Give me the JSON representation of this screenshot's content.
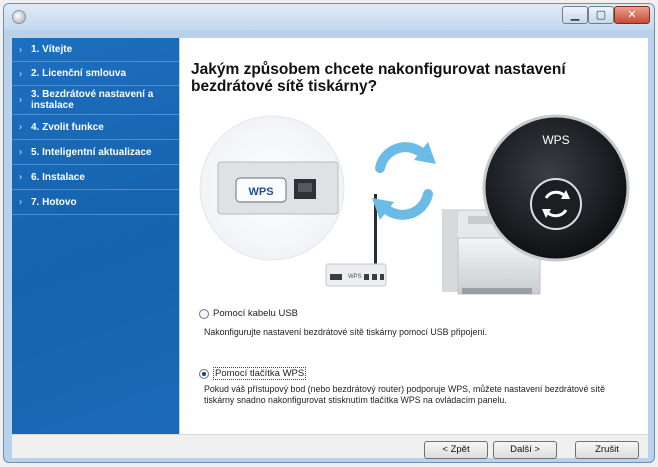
{
  "window": {
    "title": ""
  },
  "sidebar": {
    "items": [
      {
        "label": "1. Vítejte"
      },
      {
        "label": "2. Licenční smlouva"
      },
      {
        "label": "3. Bezdrátové nastavení a instalace"
      },
      {
        "label": "4. Zvolit funkce"
      },
      {
        "label": "5. Inteligentní aktualizace"
      },
      {
        "label": "6. Instalace"
      },
      {
        "label": "7. Hotovo"
      }
    ]
  },
  "main": {
    "heading": "Jakým způsobem chcete nakonfigurovat nastavení bezdrátové sítě tiskárny?",
    "illustration": {
      "wps_button_label": "WPS",
      "wps_badge_label": "WPS",
      "router_label": "WPS"
    },
    "options": [
      {
        "label": "Pomocí kabelu USB",
        "selected": false,
        "description": "Nakonfigurujte nastavení bezdrátové sítě tiskárny pomocí USB připojení."
      },
      {
        "label": "Pomocí tlačítka WPS",
        "selected": true,
        "description": "Pokud váš přístupový bod (nebo bezdrátový router) podporuje WPS, můžete nastavení bezdrátové sítě tiskárny snadno nakonfigurovat stisknutím tlačítka WPS na ovládacím panelu."
      }
    ]
  },
  "buttons": {
    "back": "< Zpět",
    "next": "Další >",
    "cancel": "Zrušit"
  },
  "titlebar": {
    "minimize": "▁",
    "maximize": "▢",
    "close": "✕"
  },
  "colors": {
    "sidebar": "#1a66b3",
    "wps_blue": "#4aa0d8"
  }
}
